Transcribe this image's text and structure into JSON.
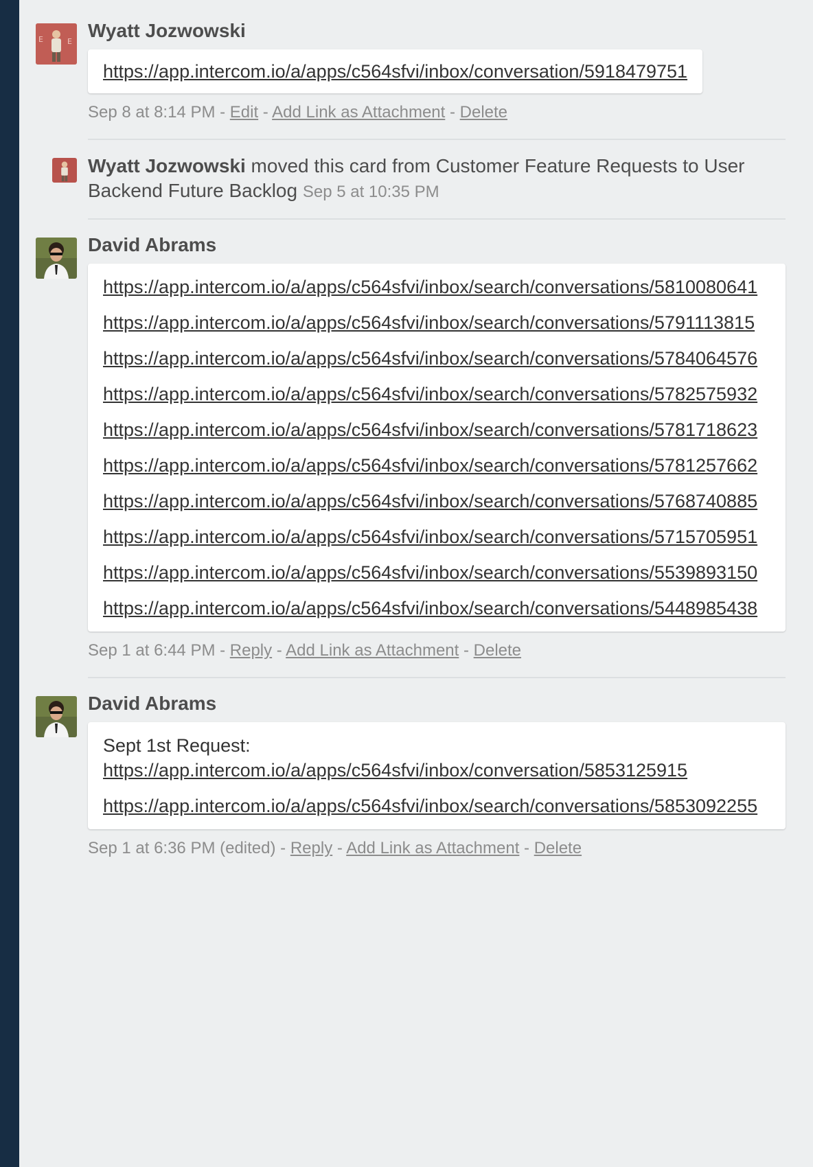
{
  "entries": [
    {
      "type": "comment",
      "author": "Wyatt Jozwowski",
      "avatar": "avatar-wyatt",
      "links": [
        "https://app.intercom.io/a/apps/c564sfvi/inbox/conversation/5918479751"
      ],
      "timestamp": "Sep 8 at 8:14 PM",
      "actions": [
        "Edit",
        "Add Link as Attachment",
        "Delete"
      ]
    },
    {
      "type": "activity",
      "author": "Wyatt Jozwowski",
      "text": "moved this card from Customer Feature Requests to User Backend Future Backlog",
      "timestamp": "Sep 5 at 10:35 PM"
    },
    {
      "type": "comment",
      "author": "David Abrams",
      "avatar": "avatar-david",
      "links": [
        "https://app.intercom.io/a/apps/c564sfvi/inbox/search/conversations/5810080641",
        "https://app.intercom.io/a/apps/c564sfvi/inbox/search/conversations/5791113815",
        "https://app.intercom.io/a/apps/c564sfvi/inbox/search/conversations/5784064576",
        "https://app.intercom.io/a/apps/c564sfvi/inbox/search/conversations/5782575932",
        "https://app.intercom.io/a/apps/c564sfvi/inbox/search/conversations/5781718623",
        "https://app.intercom.io/a/apps/c564sfvi/inbox/search/conversations/5781257662",
        "https://app.intercom.io/a/apps/c564sfvi/inbox/search/conversations/5768740885",
        "https://app.intercom.io/a/apps/c564sfvi/inbox/search/conversations/5715705951",
        "https://app.intercom.io/a/apps/c564sfvi/inbox/search/conversations/5539893150",
        "https://app.intercom.io/a/apps/c564sfvi/inbox/search/conversations/5448985438"
      ],
      "timestamp": "Sep 1 at 6:44 PM",
      "actions": [
        "Reply",
        "Add Link as Attachment",
        "Delete"
      ]
    },
    {
      "type": "comment",
      "author": "David Abrams",
      "avatar": "avatar-david",
      "intro": "Sept 1st Request:",
      "links": [
        "https://app.intercom.io/a/apps/c564sfvi/inbox/conversation/5853125915",
        "https://app.intercom.io/a/apps/c564sfvi/inbox/search/conversations/5853092255"
      ],
      "timestamp": "Sep 1 at 6:36 PM (edited)",
      "actions": [
        "Reply",
        "Add Link as Attachment",
        "Delete"
      ]
    }
  ],
  "colors": {
    "rail": "#172d44",
    "background": "#edeff0",
    "card": "#ffffff",
    "meta": "#8c8c8c"
  }
}
